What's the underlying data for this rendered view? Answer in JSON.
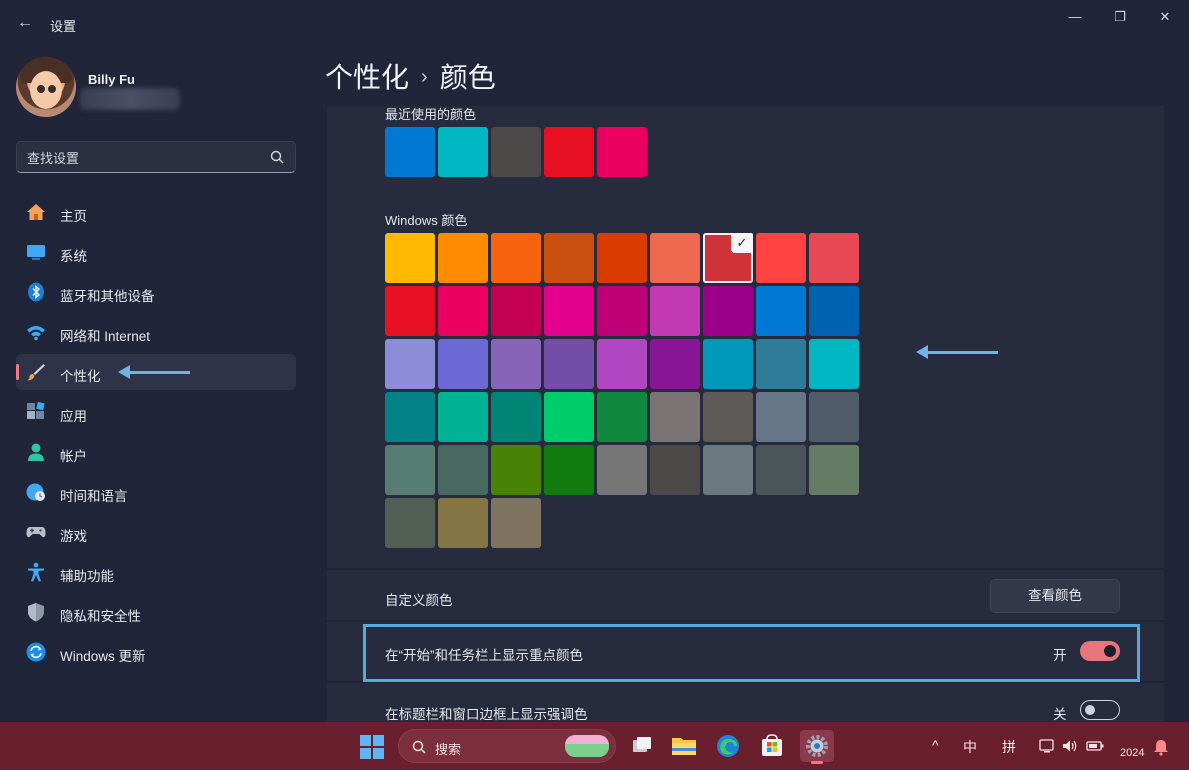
{
  "window": {
    "title": "设置",
    "back_icon": "←",
    "minimize_icon": "—",
    "restore_icon": "❐",
    "close_icon": "✕"
  },
  "user": {
    "name": "Billy Fu"
  },
  "search": {
    "placeholder": "查找设置"
  },
  "sidebar": {
    "items": [
      {
        "label": "主页",
        "icon": "home-icon",
        "active": false
      },
      {
        "label": "系统",
        "icon": "system-icon",
        "active": false
      },
      {
        "label": "蓝牙和其他设备",
        "icon": "bluetooth-icon",
        "active": false
      },
      {
        "label": "网络和 Internet",
        "icon": "wifi-icon",
        "active": false
      },
      {
        "label": "个性化",
        "icon": "brush-icon",
        "active": true
      },
      {
        "label": "应用",
        "icon": "apps-icon",
        "active": false
      },
      {
        "label": "帐户",
        "icon": "account-icon",
        "active": false
      },
      {
        "label": "时间和语言",
        "icon": "globe-clock-icon",
        "active": false
      },
      {
        "label": "游戏",
        "icon": "gamepad-icon",
        "active": false
      },
      {
        "label": "辅助功能",
        "icon": "accessibility-icon",
        "active": false
      },
      {
        "label": "隐私和安全性",
        "icon": "shield-icon",
        "active": false
      },
      {
        "label": "Windows 更新",
        "icon": "update-icon",
        "active": false
      }
    ]
  },
  "header": {
    "parent": "个性化",
    "separator": "›",
    "current": "颜色"
  },
  "recent_colors": {
    "title": "最近使用的颜色",
    "colors": [
      "#0078d4",
      "#00b7c3",
      "#4c4a48",
      "#e81123",
      "#ea005e"
    ]
  },
  "windows_colors": {
    "title": "Windows 颜色",
    "selected_index": 6,
    "check_glyph": "✓",
    "colors": [
      "#ffb900",
      "#ff8c00",
      "#f7630c",
      "#ca5010",
      "#da3b01",
      "#ef6950",
      "#d13438",
      "#ff4343",
      "#e74856",
      "#e81123",
      "#ea005e",
      "#c30052",
      "#e3008c",
      "#bf0077",
      "#c239b3",
      "#9a0089",
      "#0078d4",
      "#0063b1",
      "#8e8cd8",
      "#6b69d6",
      "#8764b8",
      "#744da9",
      "#b146c2",
      "#881798",
      "#0099bc",
      "#2d7d9a",
      "#00b7c3",
      "#038387",
      "#00b294",
      "#018574",
      "#00cc6a",
      "#10893e",
      "#7a7574",
      "#5d5a58",
      "#68768a",
      "#515c6b",
      "#567c73",
      "#486860",
      "#498205",
      "#107c10",
      "#767676",
      "#4c4a48",
      "#69797e",
      "#4a5459",
      "#647c64",
      "#525e54",
      "#847545",
      "#7e735f"
    ]
  },
  "custom_color": {
    "label": "自定义颜色",
    "button_label": "查看颜色"
  },
  "accent_start_taskbar": {
    "label": "在“开始”和任务栏上显示重点颜色",
    "state_label": "开",
    "on": true
  },
  "accent_title_bars": {
    "label": "在标题栏和窗口边框上显示强调色",
    "state_label": "关",
    "on": false
  },
  "taskbar": {
    "search_label": "搜索",
    "ime_mode": "中",
    "ime_layout": "拼",
    "clock_year": "2024",
    "tray_chevron": "^"
  },
  "colors": {
    "accent": "#e8757d",
    "highlight_annotation": "#5aa7dc",
    "taskbar_bg": "#6a1f2e"
  }
}
